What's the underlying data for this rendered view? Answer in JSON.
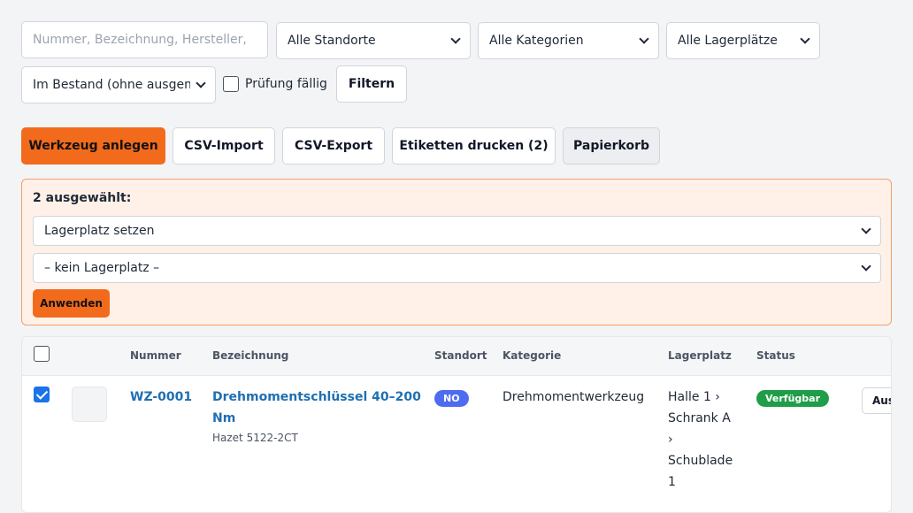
{
  "filters": {
    "search_placeholder": "Nummer, Bezeichnung, Hersteller,",
    "standort": "Alle Standorte",
    "kategorie": "Alle Kategorien",
    "lagerplatz": "Alle Lagerplätze",
    "bestand": "Im Bestand (ohne ausgem",
    "pruefung_label": "Prüfung fällig",
    "filter_button": "Filtern"
  },
  "actions": {
    "create": "Werkzeug anlegen",
    "csv_import": "CSV-Import",
    "csv_export": "CSV-Export",
    "labels": "Etiketten drucken (2)",
    "trash": "Papierkorb"
  },
  "bulk": {
    "title": "2 ausgewählt:",
    "action_select": "Lagerplatz setzen",
    "value_select": "– kein Lagerplatz –",
    "apply": "Anwenden"
  },
  "table": {
    "headers": {
      "nummer": "Nummer",
      "bezeichnung": "Bezeichnung",
      "standort": "Standort",
      "kategorie": "Kategorie",
      "lagerplatz": "Lagerplatz",
      "status": "Status"
    },
    "rows": [
      {
        "nummer": "WZ-0001",
        "bezeichnung_line1": "Drehmomentschlüssel 40–200",
        "bezeichnung_line2": "Nm",
        "hersteller": "Hazet 5122-2CT",
        "standort": "NO",
        "kategorie": "Drehmomentwerkzeug",
        "lagerplatz_lines": [
          "Halle 1 ›",
          "Schrank A",
          "›",
          "Schublade",
          "1"
        ],
        "status": "Verfügbar",
        "action": "Aus"
      }
    ]
  },
  "colors": {
    "accent": "#f26b1d",
    "link": "#1f6fb2",
    "badge_standort": "#4e6cf0",
    "badge_status": "#1f9d48"
  }
}
